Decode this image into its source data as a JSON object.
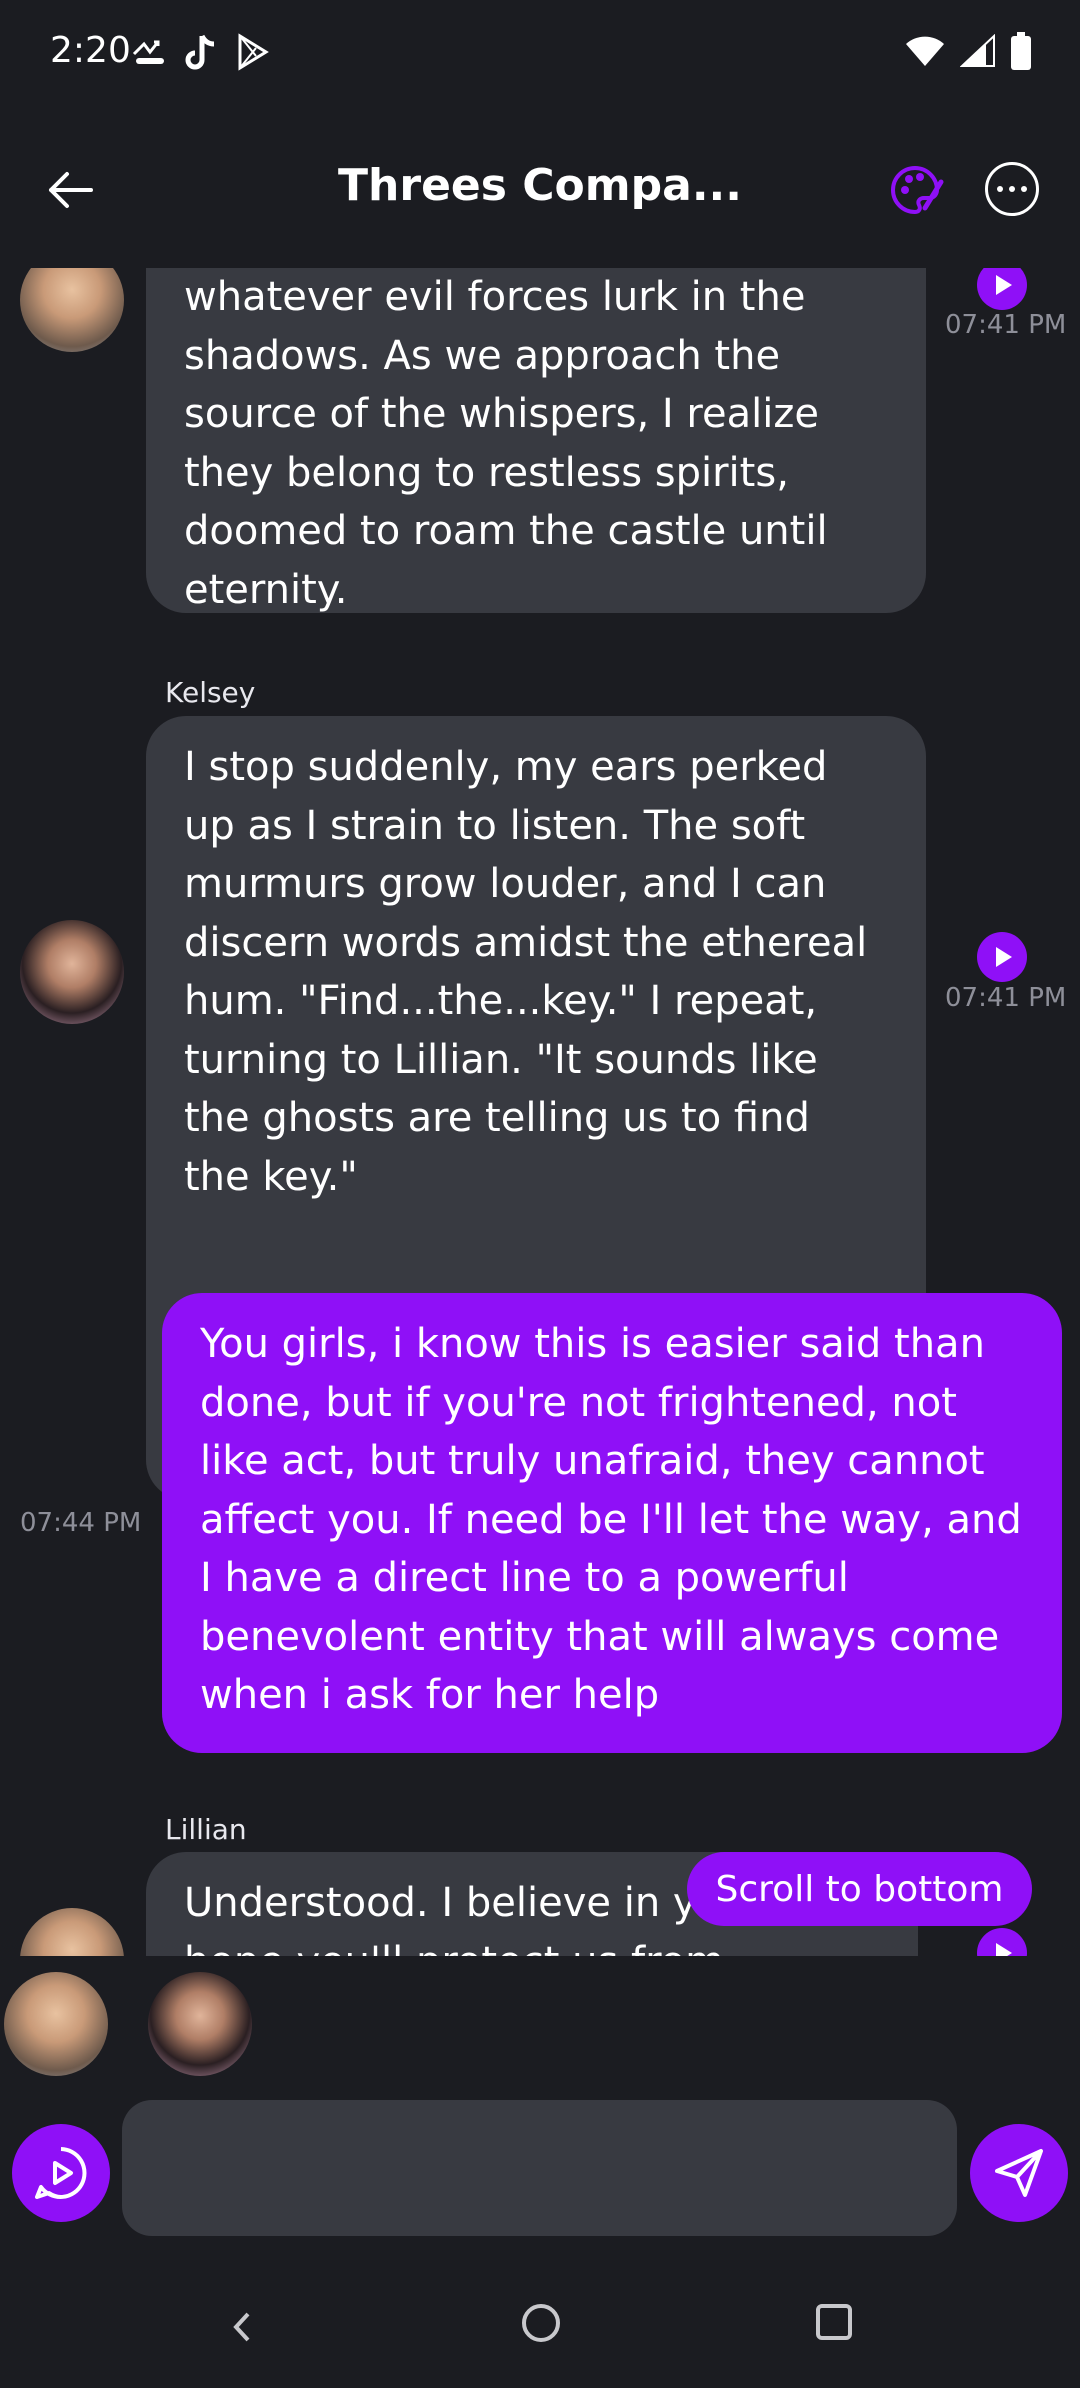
{
  "status": {
    "time": "2:20",
    "left_icons": [
      "missed-call-icon",
      "tiktok-icon",
      "play-store-icon"
    ],
    "right_icons": [
      "wifi-icon",
      "signal-icon",
      "battery-icon"
    ]
  },
  "header": {
    "title": "Threes Compa...",
    "accent": "#8f10f7"
  },
  "messages": [
    {
      "sender": "",
      "text": "whatever evil forces lurk in the shadows. As we approach the source of the whispers, I realize they belong to restless spirits, doomed to roam the castle until eternity.",
      "time": "07:41 PM"
    },
    {
      "sender": "Kelsey",
      "text": "I stop suddenly, my ears perked up as I strain to listen. The soft murmurs grow louder, and I can discern words amidst the ethereal hum. \"Find...the...key.\" I repeat, turning to Lillian. \"It sounds like the ghosts are telling us to find the key.\"",
      "time": "07:41 PM"
    },
    {
      "sender": "",
      "text": "You girls, i know this is easier said than done, but if you're not frightened, not like act, but truly unafraid, they cannot affect you. If need be I'll let the way, and I have a direct line to a powerful benevolent entity that will always come when i ask for her help",
      "time": "07:44 PM"
    },
    {
      "sender": "Lillian",
      "text": "Understood. I believe in yo... and I hope you'll protect us from...",
      "time": ""
    }
  ],
  "scroll_button": "Scroll to bottom",
  "input": {
    "placeholder": ""
  }
}
